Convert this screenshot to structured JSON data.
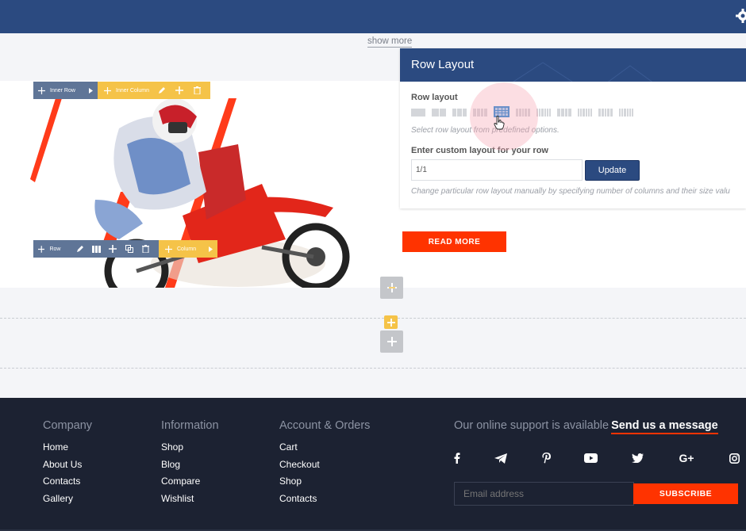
{
  "show_more": "show more",
  "toolbars": {
    "inner_row": "Inner Row",
    "inner_column": "Inner Column",
    "row": "Row",
    "column": "Column"
  },
  "panel": {
    "title": "Row Layout",
    "row_layout_label": "Row layout",
    "predefined_hint": "Select row layout from predefined options.",
    "custom_label": "Enter custom layout for your row",
    "custom_value": "1/1",
    "update_label": "Update",
    "custom_hint": "Change particular row layout manually by specifying number of columns and their size valu",
    "layout_options": [
      {
        "cols": 1
      },
      {
        "cols": 2
      },
      {
        "cols": 3
      },
      {
        "cols": 4
      },
      {
        "cols": 4,
        "active": true
      },
      {
        "cols": 5
      },
      {
        "cols": 6
      },
      {
        "cols": 4
      },
      {
        "cols": 6
      },
      {
        "cols": 5
      },
      {
        "cols": 6
      }
    ]
  },
  "read_more": "READ MORE",
  "footer": {
    "company": {
      "title": "Company",
      "links": [
        "Home",
        "About Us",
        "Contacts",
        "Gallery"
      ]
    },
    "information": {
      "title": "Information",
      "links": [
        "Shop",
        "Blog",
        "Compare",
        "Wishlist"
      ]
    },
    "account": {
      "title": "Account & Orders",
      "links": [
        "Cart",
        "Checkout",
        "Shop",
        "Contacts"
      ]
    },
    "support_text": "Our online support is available",
    "support_link": "Send us a message",
    "socials": [
      "facebook-icon",
      "telegram-icon",
      "pinterest-icon",
      "youtube-icon",
      "twitter-icon",
      "google-plus-icon",
      "instagram-icon"
    ],
    "email_placeholder": "Email address",
    "subscribe_label": "SUBSCRIBE"
  },
  "colors": {
    "brand_blue": "#2b4a80",
    "accent_red": "#ff3300",
    "builder_yellow": "#f5c348",
    "footer_bg": "#1c2232"
  }
}
